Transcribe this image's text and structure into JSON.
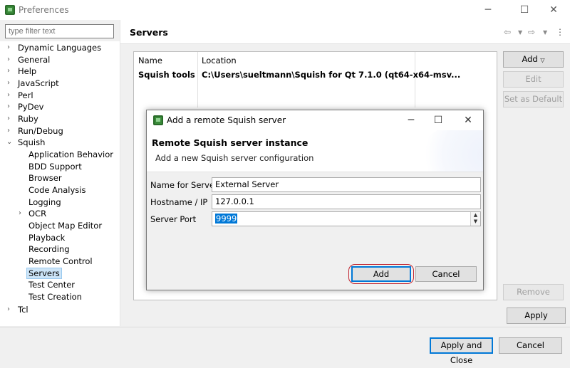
{
  "window": {
    "title": "Preferences",
    "minimize_icon": "minimize-icon",
    "maximize_icon": "maximize-icon",
    "close_icon": "close-icon"
  },
  "filter": {
    "placeholder": "type filter text"
  },
  "tree": {
    "items": [
      {
        "label": "Dynamic Languages",
        "expandable": true
      },
      {
        "label": "General",
        "expandable": true
      },
      {
        "label": "Help",
        "expandable": true
      },
      {
        "label": "JavaScript",
        "expandable": true
      },
      {
        "label": "Perl",
        "expandable": true
      },
      {
        "label": "PyDev",
        "expandable": true
      },
      {
        "label": "Ruby",
        "expandable": true
      },
      {
        "label": "Run/Debug",
        "expandable": true
      },
      {
        "label": "Squish",
        "expanded": true
      },
      {
        "label": "Application Behavior"
      },
      {
        "label": "BDD Support"
      },
      {
        "label": "Browser"
      },
      {
        "label": "Code Analysis"
      },
      {
        "label": "Logging"
      },
      {
        "label": "OCR",
        "expandable": true
      },
      {
        "label": "Object Map Editor"
      },
      {
        "label": "Playback"
      },
      {
        "label": "Recording"
      },
      {
        "label": "Remote Control"
      },
      {
        "label": "Servers",
        "selected": true
      },
      {
        "label": "Test Center"
      },
      {
        "label": "Test Creation"
      },
      {
        "label": "Tcl",
        "expandable": true
      }
    ]
  },
  "page": {
    "title": "Servers",
    "table": {
      "columns": [
        "Name",
        "Location"
      ],
      "rows": [
        [
          "Squish tools",
          "C:\\Users\\sueltmann\\Squish for Qt 7.1.0 (qt64-x64-msv..."
        ]
      ]
    },
    "buttons": {
      "add": "Add",
      "edit": "Edit",
      "set_default": "Set as Default",
      "remove": "Remove",
      "apply": "Apply"
    }
  },
  "bottom": {
    "apply_close": "Apply and Close",
    "cancel": "Cancel"
  },
  "dialog": {
    "title": "Add a remote Squish server",
    "heading": "Remote Squish server instance",
    "subtitle": "Add a new Squish server configuration",
    "fields": {
      "name_label": "Name for Server",
      "name_value": "External Server",
      "host_label": "Hostname / IP",
      "host_value": "127.0.0.1",
      "port_label": "Server Port",
      "port_value": "9999"
    },
    "add_button": "Add",
    "cancel_button": "Cancel"
  },
  "colors": {
    "accent": "#0078d7",
    "selection": "#cce4f7",
    "highlight_outline": "#c0242f",
    "app_icon": "#3a8b3a"
  }
}
